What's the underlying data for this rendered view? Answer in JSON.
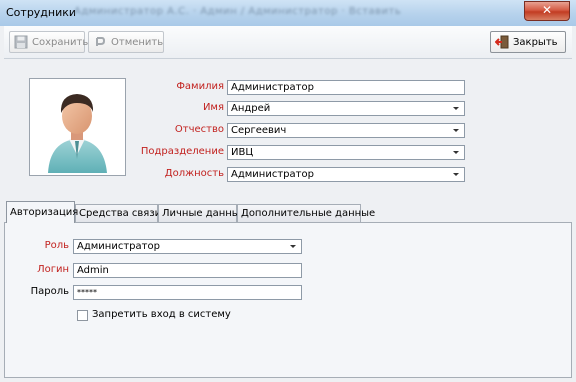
{
  "window": {
    "title": "Сотрудники",
    "subtitle_blurred": "Администратор А.С. · Админ / Администратор · Вставить",
    "close_symbol": "✕"
  },
  "toolbar": {
    "save_label": "Сохранить",
    "cancel_label": "Отменить",
    "close_label": "Закрыть"
  },
  "employee": {
    "labels": {
      "surname": "Фамилия",
      "name": "Имя",
      "patronymic": "Отчество",
      "department": "Подразделение",
      "position": "Должность"
    },
    "values": {
      "surname": "Администратор",
      "name": "Андрей",
      "patronymic": "Сергеевич",
      "department": "ИВЦ",
      "position": "Администратор"
    }
  },
  "tabs": [
    {
      "label": "Авторизация",
      "active": true
    },
    {
      "label": "Средства связи",
      "active": false
    },
    {
      "label": "Личные данные",
      "active": false
    },
    {
      "label": "Дополнительные данные",
      "active": false
    }
  ],
  "auth": {
    "role_label": "Роль",
    "role_value": "Администратор",
    "login_label": "Логин",
    "login_value": "Admin",
    "password_label": "Пароль",
    "password_value": "*****",
    "block_login_label": "Запретить вход в систему",
    "block_login_checked": false
  },
  "colors": {
    "required_label": "#c2221f",
    "titlebar": "#b6d2ec"
  }
}
